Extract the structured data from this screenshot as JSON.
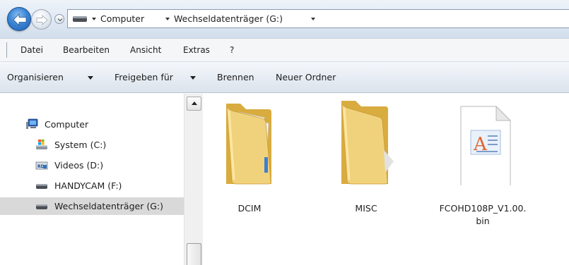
{
  "address": {
    "crumbs": [
      "Computer",
      "Wechseldatenträger (G:)"
    ]
  },
  "menu": {
    "items": [
      "Datei",
      "Bearbeiten",
      "Ansicht",
      "Extras",
      "?"
    ]
  },
  "commands": {
    "organize": "Organisieren",
    "share": "Freigeben für",
    "burn": "Brennen",
    "new_folder": "Neuer Ordner"
  },
  "nav": {
    "items": [
      {
        "label": "Computer",
        "icon": "computer-icon"
      },
      {
        "label": "System (C:)",
        "icon": "windows-drive-icon"
      },
      {
        "label": "Videos (D:)",
        "icon": "dvd-drive-icon"
      },
      {
        "label": "HANDYCAM (F:)",
        "icon": "removable-drive-icon"
      },
      {
        "label": "Wechseldatenträger (G:)",
        "icon": "removable-drive-icon",
        "selected": true
      }
    ]
  },
  "files": [
    {
      "name": "DCIM",
      "type": "folder-with-documents",
      "icon": "folder-icon"
    },
    {
      "name": "MISC",
      "type": "folder",
      "icon": "folder-icon"
    },
    {
      "name": "FCOHD108P_V1.00.bin",
      "type": "file",
      "icon": "document-file-icon"
    }
  ],
  "colors": {
    "selection": "#d9d9d9",
    "chrome_top": "#dde7f2",
    "back_button": "#3b86d6",
    "folder": "#f1d27c"
  }
}
